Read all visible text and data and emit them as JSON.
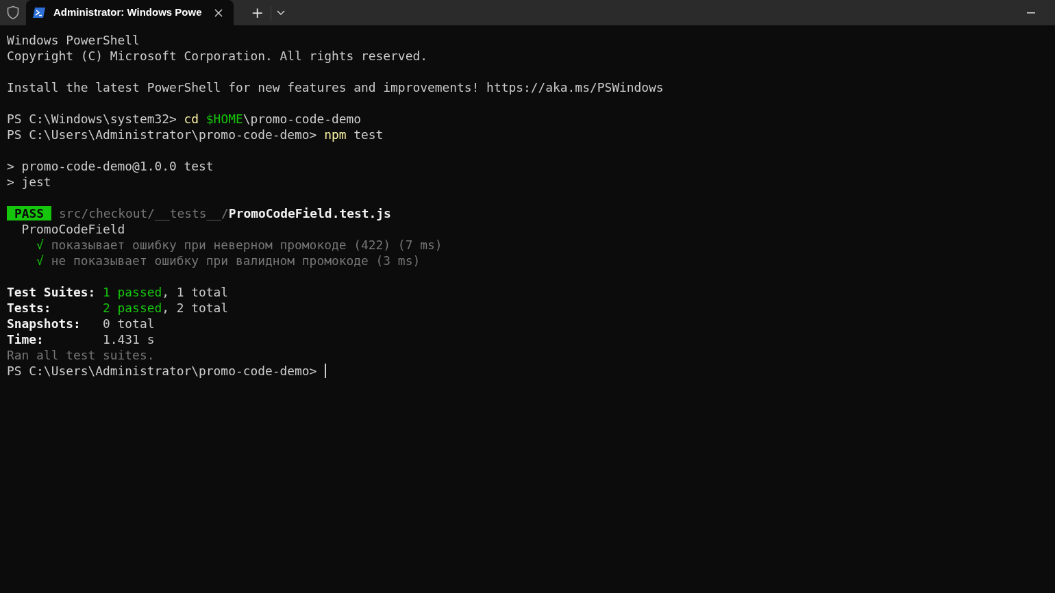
{
  "window": {
    "tabs": [
      {
        "title": "Administrator: Windows Powe",
        "selected": true
      }
    ],
    "new_tab": "+"
  },
  "terminal": {
    "lines": [
      {
        "kind": "text",
        "segments": [
          {
            "text": "Windows PowerShell",
            "kind": "plain"
          }
        ]
      },
      {
        "kind": "text",
        "segments": [
          {
            "text": "Copyright (C) Microsoft Corporation. All rights reserved.",
            "kind": "plain"
          }
        ]
      },
      {
        "kind": "blank"
      },
      {
        "kind": "text",
        "segments": [
          {
            "text": "Install the latest PowerShell for new features and improvements! https://aka.ms/PSWindows",
            "kind": "plain"
          }
        ]
      },
      {
        "kind": "blank"
      },
      {
        "kind": "text",
        "segments": [
          {
            "text": "PS C:\\Windows\\system32> ",
            "kind": "plain"
          },
          {
            "text": "cd ",
            "kind": "command"
          },
          {
            "text": "$HOME",
            "kind": "variable"
          },
          {
            "text": "\\promo-code-demo",
            "kind": "plain"
          }
        ]
      },
      {
        "kind": "text",
        "segments": [
          {
            "text": "PS C:\\Users\\Administrator\\promo-code-demo> ",
            "kind": "plain"
          },
          {
            "text": "npm",
            "kind": "command"
          },
          {
            "text": " test",
            "kind": "plain"
          }
        ]
      },
      {
        "kind": "blank"
      },
      {
        "kind": "text",
        "segments": [
          {
            "text": "> promo-code-demo@1.0.0 test",
            "kind": "plain"
          }
        ]
      },
      {
        "kind": "text",
        "segments": [
          {
            "text": "> jest",
            "kind": "plain"
          }
        ]
      },
      {
        "kind": "blank"
      },
      {
        "kind": "result",
        "badge": "PASS",
        "segments": [
          {
            "text": "src/checkout/__tests__/",
            "kind": "dim"
          },
          {
            "text": "PromoCodeField.test.js",
            "kind": "bright"
          }
        ]
      },
      {
        "kind": "text",
        "segments": [
          {
            "text": "  PromoCodeField",
            "kind": "plain"
          }
        ]
      },
      {
        "kind": "text",
        "segments": [
          {
            "text": "    √",
            "kind": "success"
          },
          {
            "text": " показывает ошибку при неверном промокоде (422) (7 ms)",
            "kind": "dim"
          }
        ]
      },
      {
        "kind": "text",
        "segments": [
          {
            "text": "    √",
            "kind": "success"
          },
          {
            "text": " не показывает ошибку при валидном промокоде (3 ms)",
            "kind": "dim"
          }
        ]
      },
      {
        "kind": "blank"
      },
      {
        "kind": "text",
        "segments": [
          {
            "text": "Test Suites: ",
            "kind": "bright"
          },
          {
            "text": "1 passed",
            "kind": "success"
          },
          {
            "text": ", 1 total",
            "kind": "plain"
          }
        ]
      },
      {
        "kind": "text",
        "segments": [
          {
            "text": "Tests:       ",
            "kind": "bright"
          },
          {
            "text": "2 passed",
            "kind": "success"
          },
          {
            "text": ", 2 total",
            "kind": "plain"
          }
        ]
      },
      {
        "kind": "text",
        "segments": [
          {
            "text": "Snapshots:   ",
            "kind": "bright"
          },
          {
            "text": "0 total",
            "kind": "plain"
          }
        ]
      },
      {
        "kind": "text",
        "segments": [
          {
            "text": "Time:        ",
            "kind": "bright"
          },
          {
            "text": "1.431 s",
            "kind": "plain"
          }
        ]
      },
      {
        "kind": "text",
        "segments": [
          {
            "text": "Ran all test suites.",
            "kind": "dim"
          }
        ]
      },
      {
        "kind": "prompt",
        "cursor": true,
        "segments": [
          {
            "text": "PS C:\\Users\\Administrator\\promo-code-demo> ",
            "kind": "plain"
          }
        ]
      }
    ]
  }
}
